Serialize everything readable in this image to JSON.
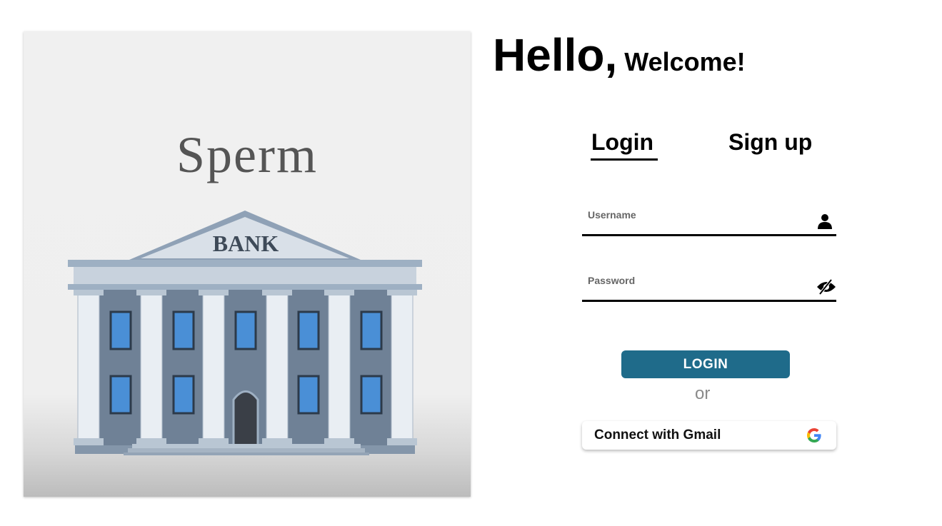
{
  "hero": {
    "brand_text": "Sperm",
    "sign_text": "BANK"
  },
  "greeting": {
    "hello": "Hello,",
    "welcome": "Welcome!"
  },
  "tabs": {
    "login_label": "Login",
    "signup_label": "Sign up",
    "active": "login"
  },
  "form": {
    "username": {
      "label": "Username",
      "value": "",
      "icon": "person-icon"
    },
    "password": {
      "label": "Password",
      "value": "",
      "icon": "eye-off-icon"
    },
    "login_button": "LOGIN",
    "or_text": "or",
    "gmail_button": "Connect with Gmail",
    "gmail_icon": "google-icon"
  },
  "colors": {
    "primary": "#1f6b8a",
    "text": "#000000",
    "muted": "#8a8a8a"
  }
}
